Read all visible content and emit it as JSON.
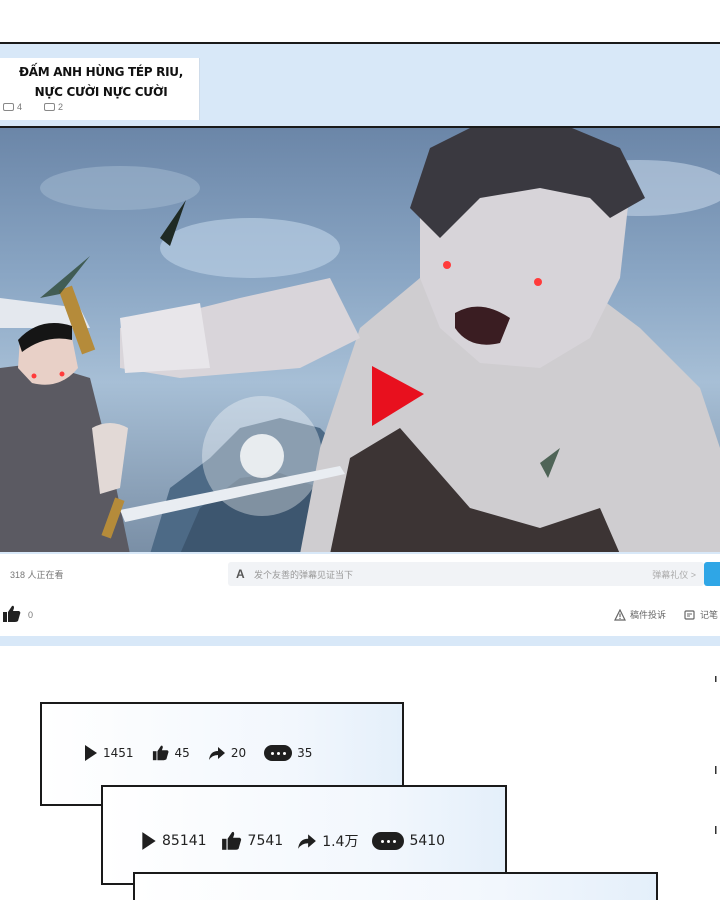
{
  "video": {
    "title": "ĐẤM ANH HÙNG TÉP RIU, NỰC CƯỜI NỰC CƯỜI",
    "views": "4",
    "comments": "2",
    "play_icon": "play-triangle-icon",
    "accent_color": "#e8101e"
  },
  "controls": {
    "viewer_count": "318 人正在看",
    "danmaku_placeholder": "发个友善的弹幕见证当下",
    "danmaku_etiquette": "弹幕礼仪 >",
    "like_count": "0",
    "report_label": "稿件投诉",
    "notes_label": "记笔"
  },
  "stats": [
    {
      "plays": "1451",
      "likes": "45",
      "shares": "20",
      "comments": "35"
    },
    {
      "plays": "85141",
      "likes": "7541",
      "shares": "1.4万",
      "comments": "5410"
    }
  ]
}
